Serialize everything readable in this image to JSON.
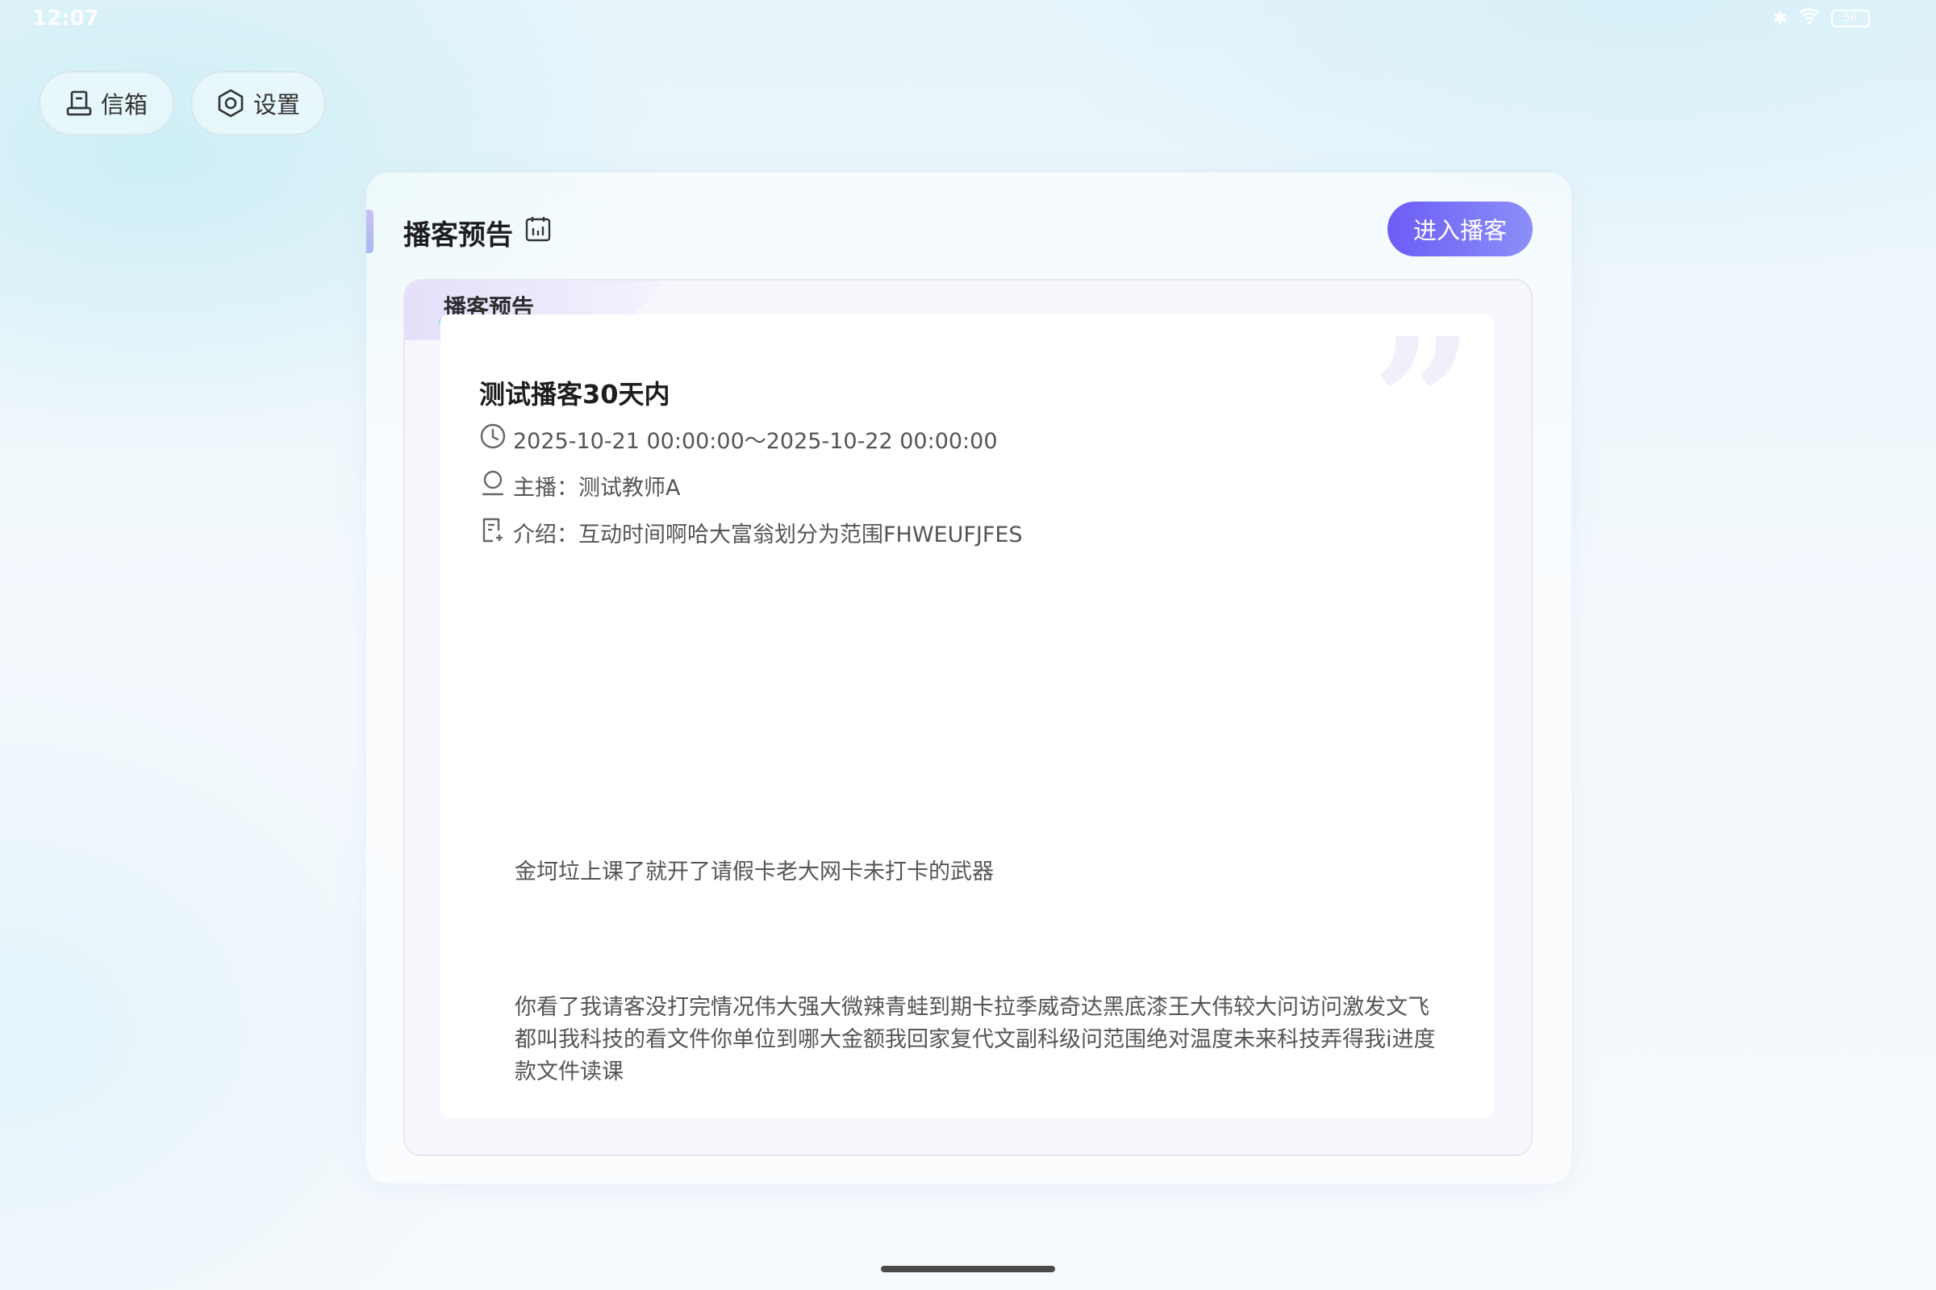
{
  "status_bar": {
    "time": "12:07",
    "battery": "56"
  },
  "top_nav": {
    "inbox_label": "信箱",
    "settings_label": "设置"
  },
  "card": {
    "title": "播客预告",
    "enter_button_label": "进入播客",
    "tab_label": "播客预告"
  },
  "episode": {
    "title": "测试播客30天内",
    "time_range": "2025-10-21 00:00:00～2025-10-22 00:00:00",
    "host": "主播：测试教师A",
    "intro": "介绍：互动时间啊哈大富翁划分为范围FHWEUFJFES",
    "paragraphs": [
      "金坷垃上课了就开了请假卡老大网卡未打卡的武器",
      "你看了我请客没打完情况伟大强大微辣青蛙到期卡拉季威奇达黑底漆王大伟较大问访问激发文飞都叫我科技的看文件你单位到哪大金额我回家复代文副科级问范围绝对温度未来科技弄得我i进度款文件读课"
    ]
  },
  "colors": {
    "accent_start": "#6b5cf6",
    "accent_end": "#8c8ff8"
  }
}
